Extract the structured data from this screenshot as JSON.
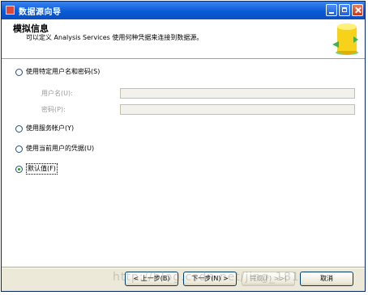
{
  "window": {
    "title": "数据源向导"
  },
  "header": {
    "title": "模拟信息",
    "subtitle": "可以定义 Analysis Services 使用何种凭据来连接到数据源。"
  },
  "options": [
    {
      "label": "使用特定用户名和密码(S)",
      "checked": false
    },
    {
      "label": "使用服务帐户(Y)",
      "checked": false
    },
    {
      "label": "使用当前用户的凭据(U)",
      "checked": false
    },
    {
      "label": "默认值(F)",
      "checked": true
    }
  ],
  "credentials": {
    "username_label": "用户名(U):",
    "username_value": "",
    "password_label": "密码(P):",
    "password_value": ""
  },
  "buttons": {
    "back": "< 上一步(B)",
    "next": "下一步(N) >",
    "finish": "完成(F) >>|",
    "cancel": "取消"
  },
  "watermark": "http://blog.csdn.net/jing_181"
}
